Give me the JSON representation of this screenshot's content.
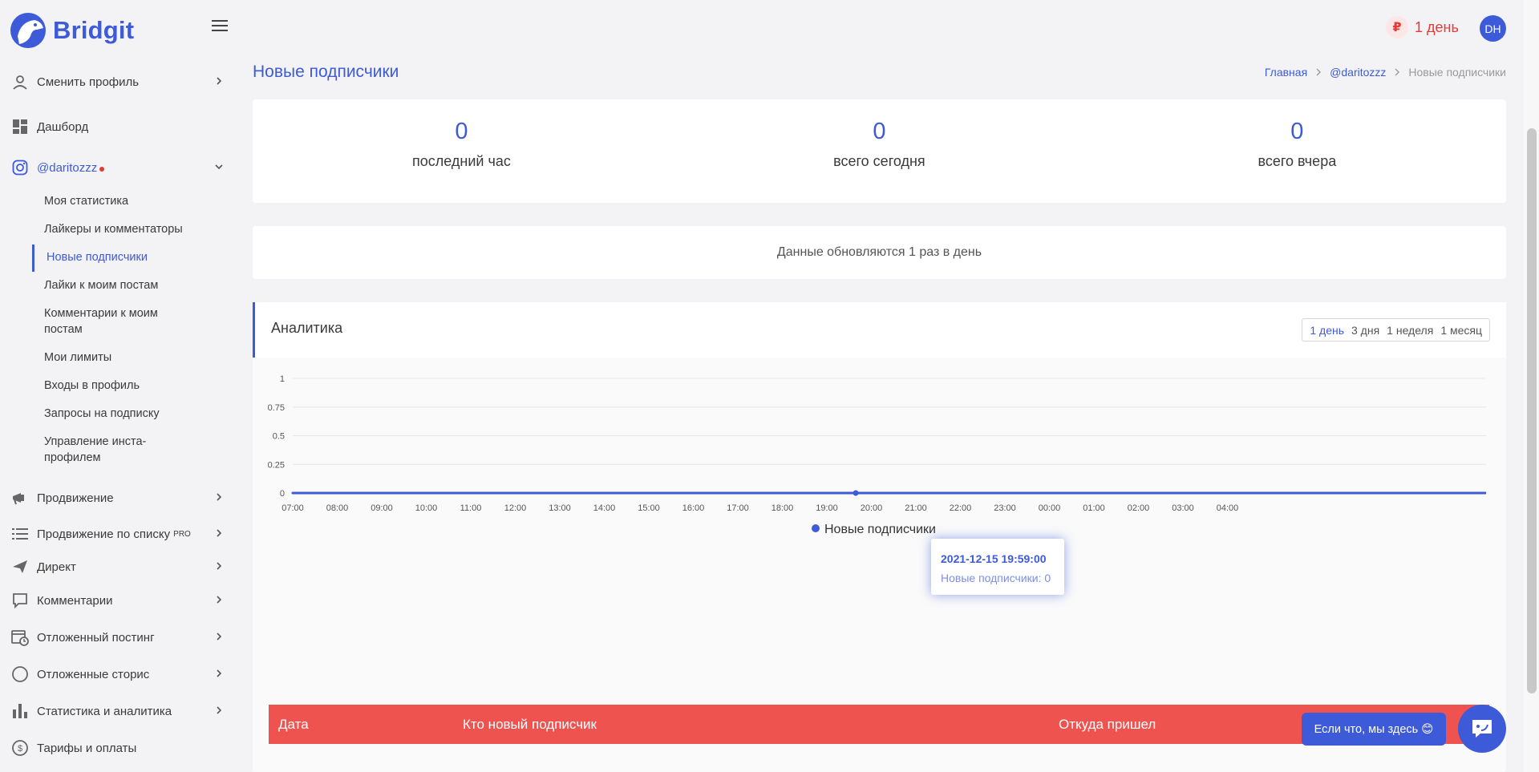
{
  "brand": {
    "name": "Bridgit"
  },
  "header": {
    "days_left": "1 день",
    "currency_icon": "ruble-icon",
    "avatar_initials": "DH"
  },
  "sidebar": {
    "items": [
      {
        "label": "Сменить профиль",
        "icon": "switch-profile-icon"
      },
      {
        "label": "Дашборд",
        "icon": "dashboard-icon"
      },
      {
        "label": "@daritozzz",
        "icon": "instagram-icon"
      },
      {
        "label": "Продвижение",
        "icon": "megaphone-icon"
      },
      {
        "label": "Продвижение по списку",
        "badge": "PRO",
        "icon": "list-icon"
      },
      {
        "label": "Директ",
        "icon": "paper-plane-icon"
      },
      {
        "label": "Комментарии",
        "icon": "comment-icon"
      },
      {
        "label": "Отложенный постинг",
        "icon": "calendar-clock-icon"
      },
      {
        "label": "Отложенные сторис",
        "icon": "circle-icon"
      },
      {
        "label": "Статистика и аналитика",
        "icon": "bar-chart-icon"
      },
      {
        "label": "Тарифы и оплаты",
        "icon": "dollar-icon"
      }
    ],
    "sub_items": [
      "Моя статистика",
      "Лайкеры и комментаторы",
      "Новые подписчики",
      "Лайки к моим постам",
      "Комментарии к моим постам",
      "Мои лимиты",
      "Входы в профиль",
      "Запросы на подписку",
      "Управление инста-профилем"
    ]
  },
  "page": {
    "title": "Новые подписчики"
  },
  "breadcrumb": [
    "Главная",
    "@daritozzz",
    "Новые подписчики"
  ],
  "stats": [
    {
      "value": "0",
      "label": "последний час"
    },
    {
      "value": "0",
      "label": "всего сегодня"
    },
    {
      "value": "0",
      "label": "всего вчера"
    }
  ],
  "notice": "Данные обновляются 1 раз в день",
  "analytics": {
    "title": "Аналитика",
    "periods": [
      "1 день",
      "3 дня",
      "1 неделя",
      "1 месяц"
    ],
    "selected_period": "1 день"
  },
  "chart_data": {
    "type": "line",
    "x": [
      "07:00",
      "08:00",
      "09:00",
      "10:00",
      "11:00",
      "12:00",
      "13:00",
      "14:00",
      "15:00",
      "16:00",
      "17:00",
      "18:00",
      "19:00",
      "20:00",
      "21:00",
      "22:00",
      "23:00",
      "00:00",
      "01:00",
      "02:00",
      "03:00",
      "04:00"
    ],
    "series": [
      {
        "name": "Новые подписчики",
        "values": [
          0,
          0,
          0,
          0,
          0,
          0,
          0,
          0,
          0,
          0,
          0,
          0,
          0,
          0,
          0,
          0,
          0,
          0,
          0,
          0,
          0,
          0
        ]
      }
    ],
    "y_ticks": [
      "0",
      "0.25",
      "0.5",
      "0.75",
      "1"
    ],
    "ylim": [
      0,
      1
    ],
    "grid": true,
    "legend": "bottom-center",
    "color": "#3d5ad8",
    "tooltip": {
      "title": "2021-12-15 19:59:00",
      "text": "Новые подписчики: 0"
    }
  },
  "table": {
    "columns": [
      "Дата",
      "Кто новый подписчик",
      "Откуда пришел"
    ]
  },
  "help": {
    "chip_text": "Если что, мы здесь 😊"
  }
}
